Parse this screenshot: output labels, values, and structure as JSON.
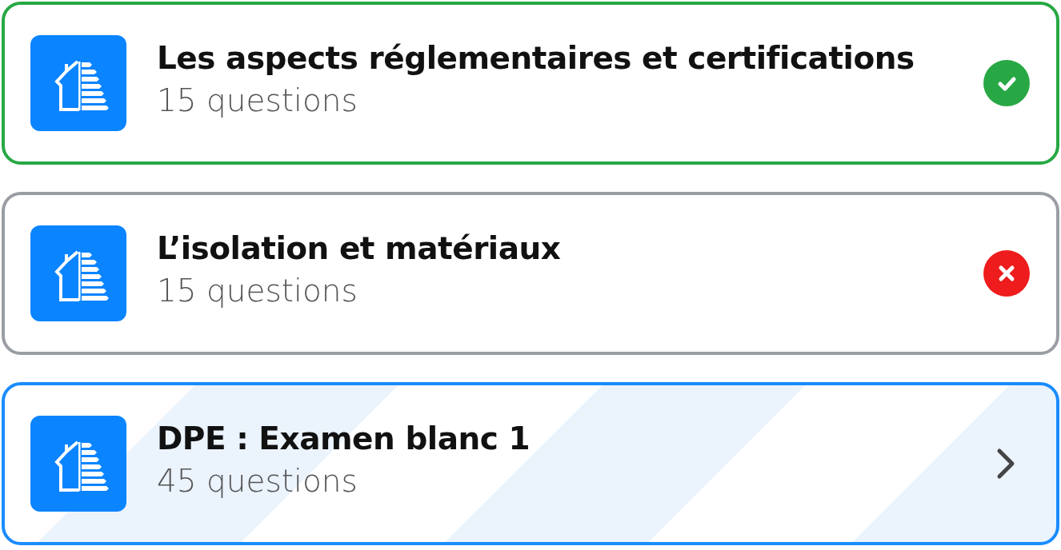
{
  "quizzes": [
    {
      "title": "Les aspects réglementaires et certifications",
      "count": "15 questions",
      "kind": "passed"
    },
    {
      "title": "L’isolation et matériaux",
      "count": "15 questions",
      "kind": "failed"
    },
    {
      "title": "DPE : Examen blanc 1",
      "count": "45 questions",
      "kind": "current"
    }
  ]
}
